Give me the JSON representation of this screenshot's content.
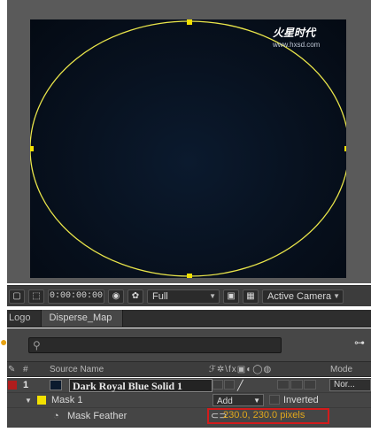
{
  "watermark": {
    "brand": "火星时代",
    "url": "www.hxsd.com"
  },
  "viewer_toolbar": {
    "timecode": "0:00:00:00",
    "resolution": "Full",
    "camera": "Active Camera"
  },
  "tabs": [
    "Logo",
    "Disperse_Map"
  ],
  "columns": {
    "hash": "#",
    "source_name": "Source Name",
    "switches": "ℱ✲\\fx▣◐◯◍",
    "mode": "Mode"
  },
  "layer": {
    "number": "1",
    "name": "Dark Royal Blue Solid 1",
    "mode": "Nor..."
  },
  "mask": {
    "name": "Mask 1",
    "mode": "Add",
    "inverted_label": "Inverted",
    "color": "#f3e100"
  },
  "mask_feather": {
    "label": "Mask Feather",
    "value": "230.0, 230.0 pixels"
  },
  "colors": {
    "mask_path": "#e9e54a",
    "feather_highlight": "#d21b1b",
    "value_text": "#e0a81c"
  }
}
